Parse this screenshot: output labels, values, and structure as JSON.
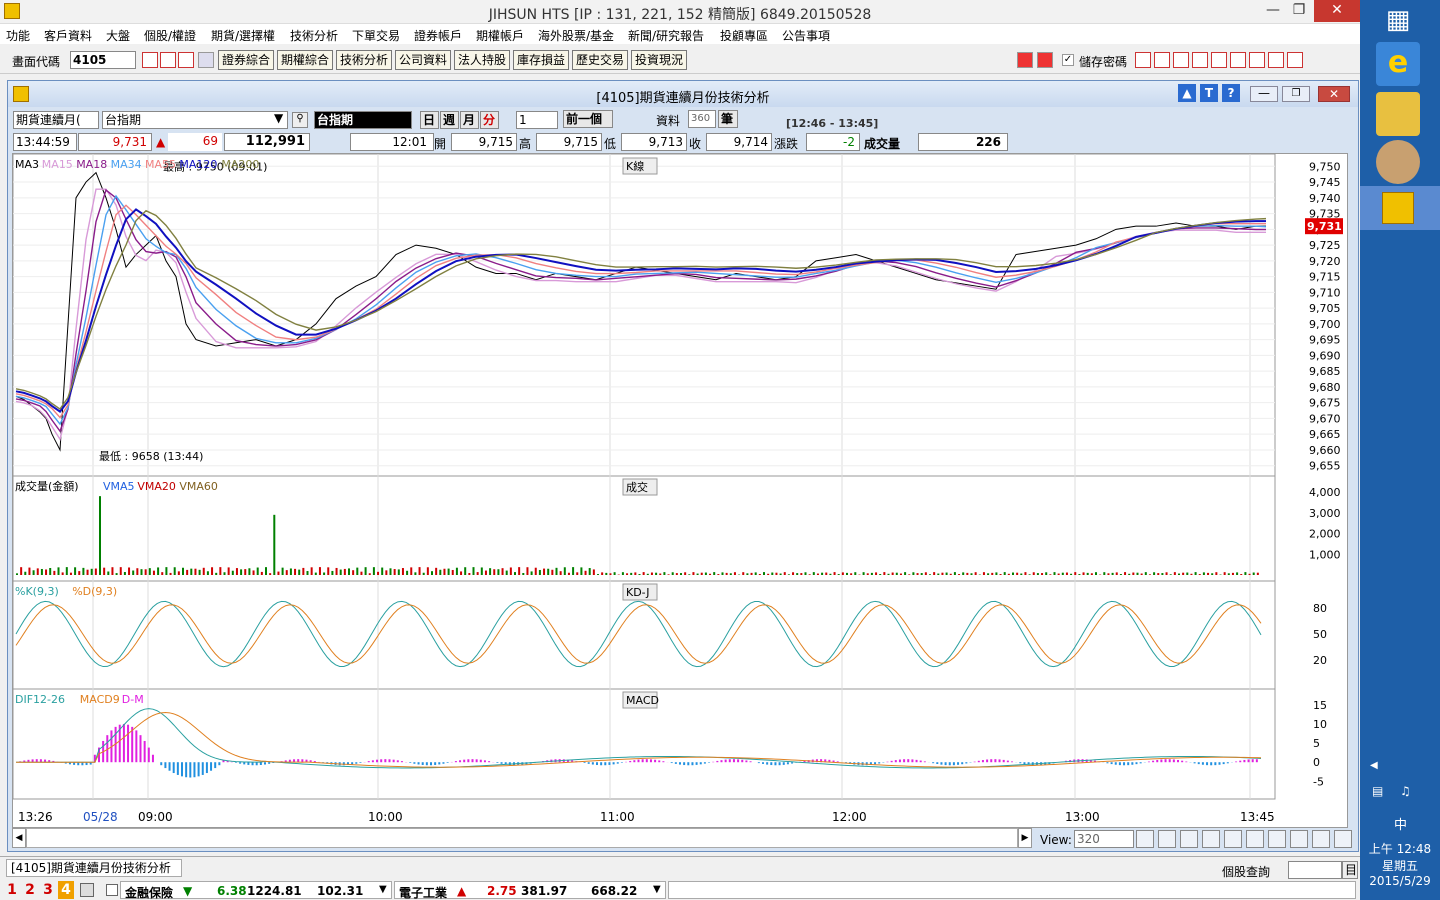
{
  "app": {
    "title": "JIHSUN HTS     [IP : 131, 221, 152 精簡版] 6849.20150528"
  },
  "menu": [
    "功能",
    "客戶資料",
    "大盤",
    "個股/權證",
    "期貨/選擇權",
    "技術分析",
    "下單交易",
    "證券帳戶",
    "期權帳戶",
    "海外股票/基金",
    "新聞/研究報告",
    "投顧專區",
    "公告事項"
  ],
  "toolbar": {
    "code_label": "畫面代碼",
    "code_value": "4105",
    "buttons": [
      "證券綜合",
      "期權綜合",
      "技術分析",
      "公司資料",
      "法人持股",
      "庫存損益",
      "歷史交易",
      "投資現況"
    ],
    "save_pwd": "儲存密碼"
  },
  "window": {
    "title": "[4105]期貨連續月份技術分析"
  },
  "controls": {
    "product": "期貨連續月(",
    "symbol": "台指期",
    "selected": "台指期",
    "periods": [
      "日",
      "週",
      "月",
      "分"
    ],
    "period_n": "1",
    "prev": "前一個",
    "data_label": "資料",
    "data_count": "360",
    "data_unit": "筆",
    "time_range": "[12:46 - 13:45]"
  },
  "quote": {
    "time": "13:44:59",
    "last": "9,731",
    "arrow": "▲",
    "change": "69",
    "volume": "112,991",
    "bar_time": "12:01",
    "open_label": "開",
    "open": "9,715",
    "high_label": "高",
    "high": "9,715",
    "low_label": "低",
    "low": "9,713",
    "close_label": "收",
    "close": "9,714",
    "chg_label": "漲跌",
    "chg": "-2",
    "vol_label": "成交量",
    "vol": "226"
  },
  "panes": {
    "k": {
      "title": "K線",
      "legend": [
        {
          "t": "MA3",
          "c": "#000000"
        },
        {
          "t": "MA15",
          "c": "#d89ad8"
        },
        {
          "t": "MA18",
          "c": "#8a1c8a"
        },
        {
          "t": "MA34",
          "c": "#4aa0f0"
        },
        {
          "t": "MA55",
          "c": "#f08080"
        },
        {
          "t": "MA120",
          "c": "#1010c0"
        },
        {
          "t": "MA200",
          "c": "#808040"
        }
      ],
      "hi": "最高 : 9750 (09:01)",
      "lo": "最低 : 9658 (13:44)",
      "last_tag": "9,731"
    },
    "vol": {
      "title": "成交",
      "legend": [
        {
          "t": "成交量(金額)",
          "c": "#000000"
        },
        {
          "t": "VMA5",
          "c": "#2060e0"
        },
        {
          "t": "VMA20",
          "c": "#c00000"
        },
        {
          "t": "VMA60",
          "c": "#806020"
        }
      ]
    },
    "kd": {
      "title": "KD-J",
      "legend": [
        {
          "t": "%K(9,3)",
          "c": "#2aa0a0"
        },
        {
          "t": "%D(9,3)",
          "c": "#e08020"
        }
      ]
    },
    "macd": {
      "title": "MACD",
      "legend": [
        {
          "t": "DIF12-26",
          "c": "#2aa0a0"
        },
        {
          "t": "MACD9",
          "c": "#e08020"
        },
        {
          "t": "D-M",
          "c": "#e020e0"
        }
      ]
    }
  },
  "xlabels": [
    "13:26",
    "05/28",
    "09:00",
    "10:00",
    "11:00",
    "12:00",
    "13:00",
    "13:45"
  ],
  "view": {
    "label": "View:",
    "value": "320"
  },
  "tab": "[4105]期貨連續月份技術分析",
  "query": "個股查詢",
  "query_btn": "目",
  "status": {
    "pages": [
      "1",
      "2",
      "3",
      "4"
    ],
    "t1": {
      "name": "金融保險",
      "arrow": "▼",
      "chg": "6.38",
      "idx": "1224.81",
      "vol": "102.31"
    },
    "t2": {
      "name": "電子工業",
      "arrow": "▲",
      "chg": "2.75",
      "idx": "381.97",
      "vol": "668.22"
    }
  },
  "clock": {
    "ime": "中",
    "time": "上午 12:48",
    "day": "星期五",
    "date": "2015/5/29"
  },
  "chart_data": [
    {
      "type": "line",
      "title": "K線",
      "ylim": [
        9653,
        9752
      ],
      "yticks": [
        9750,
        9745,
        9740,
        9735,
        9730,
        9725,
        9720,
        9715,
        9710,
        9705,
        9700,
        9695,
        9690,
        9685,
        9680,
        9675,
        9670,
        9665,
        9660,
        9655
      ],
      "x": [
        0,
        8,
        16,
        24,
        30,
        36,
        44,
        52,
        60,
        70,
        80,
        90,
        100,
        110,
        120,
        130,
        140,
        150,
        160,
        170,
        180,
        200,
        220,
        240,
        260,
        280,
        300,
        320,
        340,
        360,
        380,
        400,
        420,
        440,
        460,
        480,
        500,
        520,
        540,
        560,
        580,
        600,
        620,
        640,
        660,
        680,
        700,
        720,
        740,
        760,
        780,
        800,
        820,
        840,
        860,
        880,
        900,
        920,
        940,
        960,
        980,
        1000,
        1020,
        1040,
        1060,
        1080,
        1100,
        1120,
        1140,
        1160,
        1180,
        1200,
        1220,
        1240,
        1250
      ],
      "series": [
        {
          "name": "MA3",
          "values": [
            9677,
            9676,
            9674,
            9672,
            9670,
            9665,
            9660,
            9700,
            9740,
            9745,
            9748,
            9740,
            9730,
            9718,
            9722,
            9725,
            9728,
            9720,
            9715,
            9700,
            9695,
            9693,
            9694,
            9695,
            9693,
            9695,
            9700,
            9708,
            9712,
            9715,
            9722,
            9725,
            9724,
            9722,
            9718,
            9716,
            9716,
            9714,
            9716,
            9715,
            9714,
            9716,
            9718,
            9717,
            9716,
            9715,
            9714,
            9716,
            9715,
            9714,
            9715,
            9720,
            9721,
            9722,
            9720,
            9718,
            9716,
            9714,
            9713,
            9712,
            9711,
            9722,
            9723,
            9724,
            9725,
            9727,
            9730,
            9731,
            9731,
            9732,
            9731,
            9731,
            9730,
            9731,
            9731
          ]
        }
      ]
    },
    {
      "type": "bar",
      "title": "成交",
      "ylim": [
        0,
        4000
      ],
      "yticks": [
        4000,
        3000,
        2000,
        1000
      ]
    },
    {
      "type": "line",
      "title": "KD-J",
      "ylim": [
        0,
        100
      ],
      "yticks": [
        80,
        50,
        20
      ]
    },
    {
      "type": "bar",
      "title": "MACD",
      "ylim": [
        -7,
        16
      ],
      "yticks": [
        15,
        10,
        5,
        0,
        -5
      ]
    }
  ]
}
